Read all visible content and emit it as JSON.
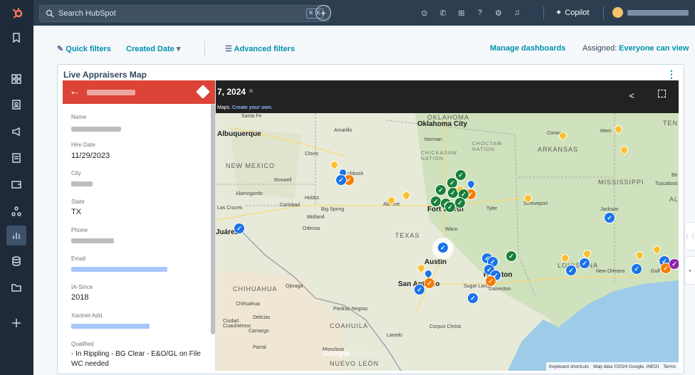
{
  "topbar": {
    "search_placeholder": "Search HubSpot",
    "search_shortcut": "⌘ K",
    "copilot_label": "Copilot"
  },
  "filters": {
    "quick_filters": "Quick filters",
    "created_date": "Created Date",
    "advanced_filters": "Advanced filters",
    "manage_dashboards": "Manage dashboards",
    "assigned_label": "Assigned:",
    "assigned_value": "Everyone can view"
  },
  "card": {
    "title": "Live Appraisers Map"
  },
  "panel": {
    "fields": [
      {
        "label": "Name",
        "value": ""
      },
      {
        "label": "Hire Date",
        "value": "11/29/2023"
      },
      {
        "label": "City",
        "value": ""
      },
      {
        "label": "State",
        "value": "TX"
      },
      {
        "label": "Phone",
        "value": ""
      },
      {
        "label": "Email",
        "value": ""
      },
      {
        "label": "IA-Since",
        "value": "2018"
      },
      {
        "label": "Xactnet Add.",
        "value": ""
      },
      {
        "label": "Qualified",
        "value": "- In Rippling - BG Clear - E&O/GL on File"
      },
      {
        "label": "",
        "value": "WC needed"
      }
    ]
  },
  "map": {
    "title": "7, 2024",
    "subtitle_prefix": "Maps.",
    "subtitle_link": "Create your own.",
    "google_logo": "Google",
    "google_suffix": "My Maps",
    "attribution": [
      "Keyboard shortcuts",
      "Map data ©2024 Google, INEGI",
      "Terms"
    ],
    "labels": {
      "oklahoma": "OKLAHOMA",
      "oklahoma_city": "Oklahoma City",
      "norman": "Norman",
      "chickasaw": "CHICKASAW NATION",
      "choctaw": "CHOCTAW NATION",
      "arkansas": "ARKANSAS",
      "conway": "Conway",
      "memphis": "Mem",
      "tennessee": "TEN",
      "santa_fe": "Santa Fe",
      "albuquerque": "Albuquerque",
      "amarillo": "Amarillo",
      "clovis": "Clovis",
      "new_mexico": "NEW MEXICO",
      "roswell": "Roswell",
      "lubbock": "Lubbock",
      "alamogordo": "Alamogordo",
      "hobbs": "Hobbs",
      "carlsbad": "Carlsbad",
      "las_cruces": "Las Cruces",
      "big_spring": "Big Spring",
      "midland": "Midland",
      "odessa": "Odessa",
      "abilene": "Abilene",
      "fort_worth": "Fort Worth",
      "tyler": "Tyler",
      "shreveport": "Shreveport",
      "mississippi": "MISSISSIPPI",
      "tuscaloosa": "Tuscaloos",
      "jackson": "Jackson",
      "juarez": "Juárez",
      "texas": "TEXAS",
      "waco": "Waco",
      "austin": "Austin",
      "houston": "Houston",
      "san_antonio": "San Antonio",
      "sugar_land": "Sugar Land",
      "galveston": "Galveston",
      "louisiana": "LOUISIANA",
      "new_orleans": "New Orleans",
      "gulfport": "Gulf",
      "chihuahua_state": "CHIHUAHUA",
      "ojinaga": "Ojinaga",
      "chihuahua": "Chihuahua",
      "piedras_negras": "Piedras Negras",
      "delicias": "Delicias",
      "ciudad_cuauhtemoc": "Ciudad Cuauhtémoc",
      "camargo": "Camargo",
      "coahuila": "COAHUILA",
      "corpus_christi": "Corpus Christi",
      "laredo": "Laredo",
      "parral": "Parral",
      "monclova": "Monclova",
      "nuevo_leon": "NUEVO LEÓN",
      "alabama": "AL",
      "birmingham": "Bir"
    }
  },
  "colors": {
    "accent": "#0091ae",
    "header_red": "#db4437",
    "rail_bg": "#1e2a3a",
    "topbar_bg": "#2d3e50"
  }
}
